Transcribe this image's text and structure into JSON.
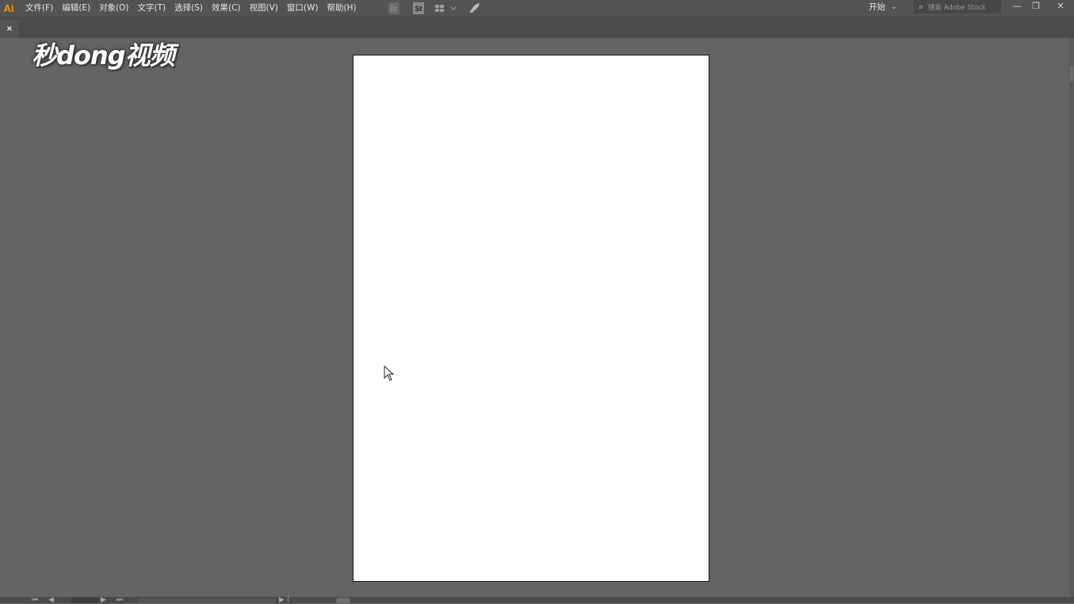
{
  "app": {
    "logo": "Ai"
  },
  "menu": [
    {
      "label": "文件(F)"
    },
    {
      "label": "编辑(E)"
    },
    {
      "label": "对象(O)"
    },
    {
      "label": "文字(T)"
    },
    {
      "label": "选择(S)"
    },
    {
      "label": "效果(C)"
    },
    {
      "label": "视图(V)"
    },
    {
      "label": "窗口(W)"
    },
    {
      "label": "帮助(H)"
    }
  ],
  "toolbar": {
    "bridge_label": "Br",
    "stock_label": "St",
    "arrange_icon": "arrange-documents-icon",
    "gpu_icon": "rocket-icon"
  },
  "workspace": {
    "label": "开始",
    "chevron": "⌄"
  },
  "search": {
    "icon": "⌕",
    "placeholder": "搜索 Adobe Stock"
  },
  "window_controls": {
    "minimize": "—",
    "restore": "❐",
    "close": "✕"
  },
  "document_tab": {
    "close": "×"
  },
  "watermark": {
    "text": "秒dong视频"
  },
  "colors": {
    "canvas_bg": "#646464",
    "menubar_bg": "#535353",
    "artboard": "#ffffff",
    "accent": "#ff9a00"
  },
  "status": {
    "nav_prev": "⏮ ◀",
    "nav_next": "▶ ⏭",
    "play": "▶ ⟨"
  }
}
